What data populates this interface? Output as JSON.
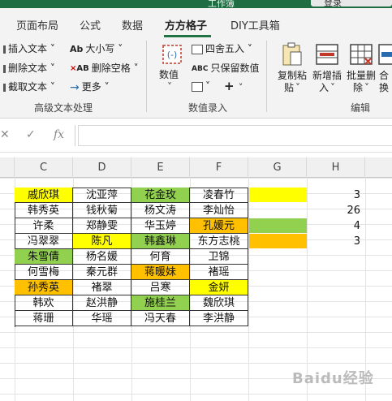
{
  "window": {
    "title": "工作簿",
    "user": "登录"
  },
  "tabs": [
    "页面布局",
    "公式",
    "数据",
    "方方格子",
    "DIY工具箱"
  ],
  "active_tab": "方方格子",
  "ribbon": {
    "text_group": {
      "insert_text": "插入文本",
      "delete_text": "删除文本",
      "cut_text": "截取文本",
      "font_size": "大小写",
      "delete_space": "删除空格",
      "more": "更多",
      "label": "高级文本处理"
    },
    "number_group": {
      "value": "数值",
      "round": "四舍五入",
      "keep_value": "只保留数值",
      "label": "数值录入"
    },
    "edit_group": {
      "copy_paste_1": "复制粘",
      "copy_paste_2": "贴",
      "new_insert_1": "新增插",
      "new_insert_2": "入",
      "batch_delete_1": "批量删",
      "batch_delete_2": "除",
      "merge_1": "合",
      "merge_2": "换",
      "label": "编辑"
    }
  },
  "formula_bar": {
    "fx": "fx",
    "content": ""
  },
  "columns": [
    "C",
    "D",
    "E",
    "F",
    "G",
    "H"
  ],
  "table": [
    [
      "戚欣琪",
      "沈亚萍",
      "花金玫",
      "凌春竹"
    ],
    [
      "韩秀英",
      "钱秋菊",
      "杨文涛",
      "李灿怡"
    ],
    [
      "许柔",
      "郑静雯",
      "华玉婷",
      "孔媛元"
    ],
    [
      "冯翠翠",
      "陈凡",
      "韩鑫琳",
      "东方志桃"
    ],
    [
      "朱雪倩",
      "杨名媛",
      "何育",
      "卫锦"
    ],
    [
      "何雪梅",
      "秦元群",
      "蒋暖妹",
      "褚瑶"
    ],
    [
      "孙秀英",
      "褚翠",
      "吕寒",
      "金妍"
    ],
    [
      "韩欢",
      "赵洪静",
      "施桂兰",
      "魏欣琪"
    ],
    [
      "蒋珊",
      "华瑶",
      "冯天春",
      "李洪静"
    ]
  ],
  "legend_counts": [
    "3",
    "26",
    "4",
    "3"
  ],
  "colors": {
    "yellow": "#ffff00",
    "green": "#92d050",
    "orange": "#ffc000",
    "accent": "#217346"
  },
  "watermark": {
    "text": "Baidu经验",
    "sub": "jingyan.baidu.com"
  }
}
